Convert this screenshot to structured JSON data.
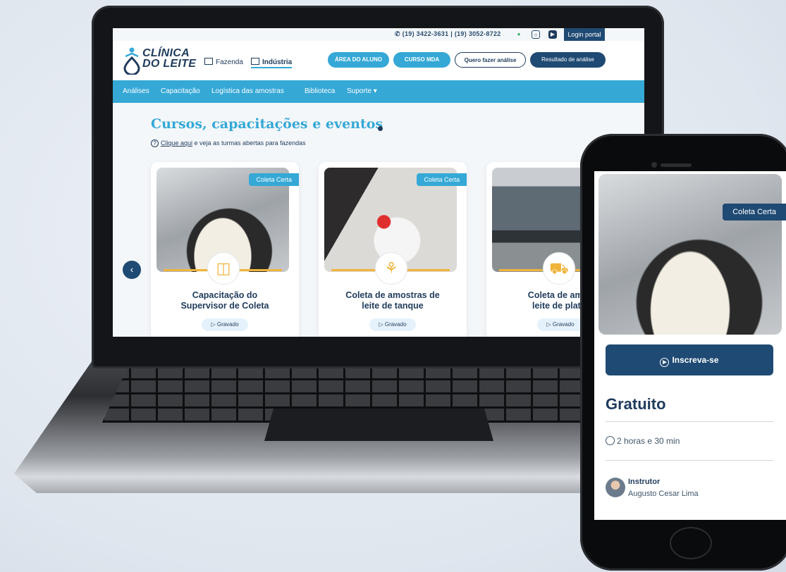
{
  "site": {
    "logo": [
      "CLÍNICA",
      "DO LEITE"
    ],
    "topbar": {
      "phones": "(19) 3422-3631 | (19) 3052-8722",
      "login": "Login portal"
    },
    "segments": [
      "Fazenda",
      "Indústria"
    ],
    "header_buttons": {
      "aluno": "ÁREA DO ALUNO",
      "mda": "CURSO MDA",
      "quero": "Quero fazer análise",
      "resultado": "Resultado de análise"
    },
    "nav": [
      "Análises",
      "Capacitação",
      "Logística das amostras",
      "Biblioteca",
      "Suporte ▾"
    ],
    "page_title": "Cursos, capacitações e eventos",
    "subline": {
      "link": "Clique aqui",
      "rest": " e veja as turmas abertas para fazendas"
    },
    "cards": [
      {
        "badge": "Coleta Certa",
        "title_line1": "Capacitação do",
        "title_line2": "Supervisor de Coleta",
        "pill": "Gravado"
      },
      {
        "badge": "Coleta Certa",
        "title_line1": "Coleta de amostras de",
        "title_line2": "leite de tanque",
        "pill": "Gravado"
      },
      {
        "badge": "",
        "title_line1": "Coleta de amos",
        "title_line2": "leite de plataf",
        "pill": "Gravado"
      }
    ]
  },
  "phone": {
    "badge": "Coleta Certa",
    "cta": "Inscreva-se",
    "price": "Gratuito",
    "duration": "2 horas e 30 min",
    "instructor_label": "Instrutor",
    "instructor_name": "Augusto Cesar Lima"
  }
}
